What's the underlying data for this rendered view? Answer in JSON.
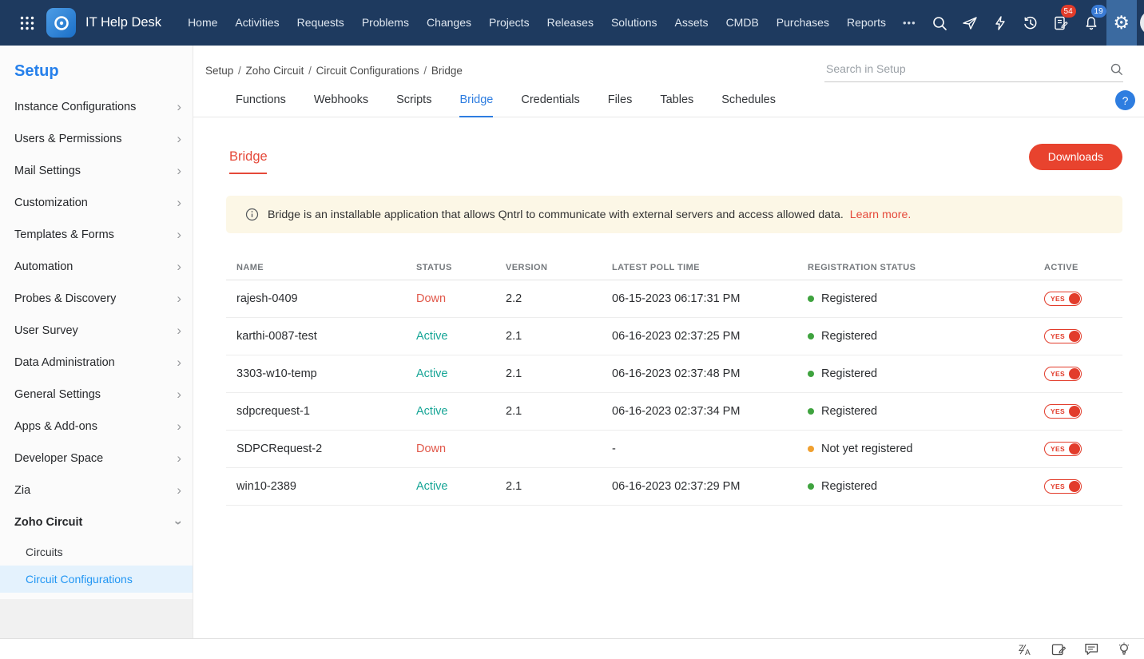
{
  "topnav": {
    "app_title": "IT Help Desk",
    "nav_items": [
      "Home",
      "Activities",
      "Requests",
      "Problems",
      "Changes",
      "Projects",
      "Releases",
      "Solutions",
      "Assets",
      "CMDB",
      "Purchases",
      "Reports"
    ],
    "more_label": "•••",
    "badge_tasks": "54",
    "badge_notifications": "19"
  },
  "sidebar": {
    "title": "Setup",
    "items": [
      "Instance Configurations",
      "Users & Permissions",
      "Mail Settings",
      "Customization",
      "Templates & Forms",
      "Automation",
      "Probes & Discovery",
      "User Survey",
      "Data Administration",
      "General Settings",
      "Apps & Add-ons",
      "Developer Space",
      "Zia"
    ],
    "expanded_item": "Zoho Circuit",
    "sub_items": [
      "Circuits",
      "Circuit Configurations"
    ],
    "active_sub_item": "Circuit Configurations"
  },
  "content": {
    "breadcrumb": [
      "Setup",
      "Zoho Circuit",
      "Circuit Configurations",
      "Bridge"
    ],
    "breadcrumb_separator": "/",
    "search_placeholder": "Search in Setup",
    "tabs": [
      "Functions",
      "Webhooks",
      "Scripts",
      "Bridge",
      "Credentials",
      "Files",
      "Tables",
      "Schedules"
    ],
    "active_tab": "Bridge",
    "help_label": "?",
    "section_title": "Bridge",
    "downloads_button": "Downloads",
    "info_text": "Bridge is an installable application that allows Qntrl to communicate with external servers and access allowed data.",
    "learn_more": "Learn more."
  },
  "table": {
    "headers": [
      "NAME",
      "STATUS",
      "VERSION",
      "LATEST POLL TIME",
      "REGISTRATION STATUS",
      "ACTIVE"
    ],
    "rows": [
      {
        "name": "rajesh-0409",
        "status": "Down",
        "version": "2.2",
        "poll_time": "06-15-2023 06:17:31 PM",
        "registration": "Registered",
        "active": "YES"
      },
      {
        "name": "karthi-0087-test",
        "status": "Active",
        "version": "2.1",
        "poll_time": "06-16-2023 02:37:25 PM",
        "registration": "Registered",
        "active": "YES"
      },
      {
        "name": "3303-w10-temp",
        "status": "Active",
        "version": "2.1",
        "poll_time": "06-16-2023 02:37:48 PM",
        "registration": "Registered",
        "active": "YES"
      },
      {
        "name": "sdpcrequest-1",
        "status": "Active",
        "version": "2.1",
        "poll_time": "06-16-2023 02:37:34 PM",
        "registration": "Registered",
        "active": "YES"
      },
      {
        "name": "SDPCRequest-2",
        "status": "Down",
        "version": "",
        "poll_time": "-",
        "registration": "Not yet registered",
        "active": "YES"
      },
      {
        "name": "win10-2389",
        "status": "Active",
        "version": "2.1",
        "poll_time": "06-16-2023 02:37:29 PM",
        "registration": "Registered",
        "active": "YES"
      }
    ]
  },
  "colors": {
    "topnav_bg": "#1e3a5f",
    "accent_blue": "#2e7de0",
    "accent_red": "#e5493a",
    "downloads_button_red": "#e8432e",
    "status_down_red": "#e1584a",
    "status_active_teal": "#16a596",
    "registered_dot_green": "#3fa33f",
    "not_registered_dot_orange": "#f0a030",
    "sidebar_active_bg": "#e4f2fd",
    "sidebar_active_text": "#2196f3",
    "banner_bg": "#fcf7e6",
    "badge_red": "#e23c2b",
    "badge_blue": "#3a7bd5"
  }
}
